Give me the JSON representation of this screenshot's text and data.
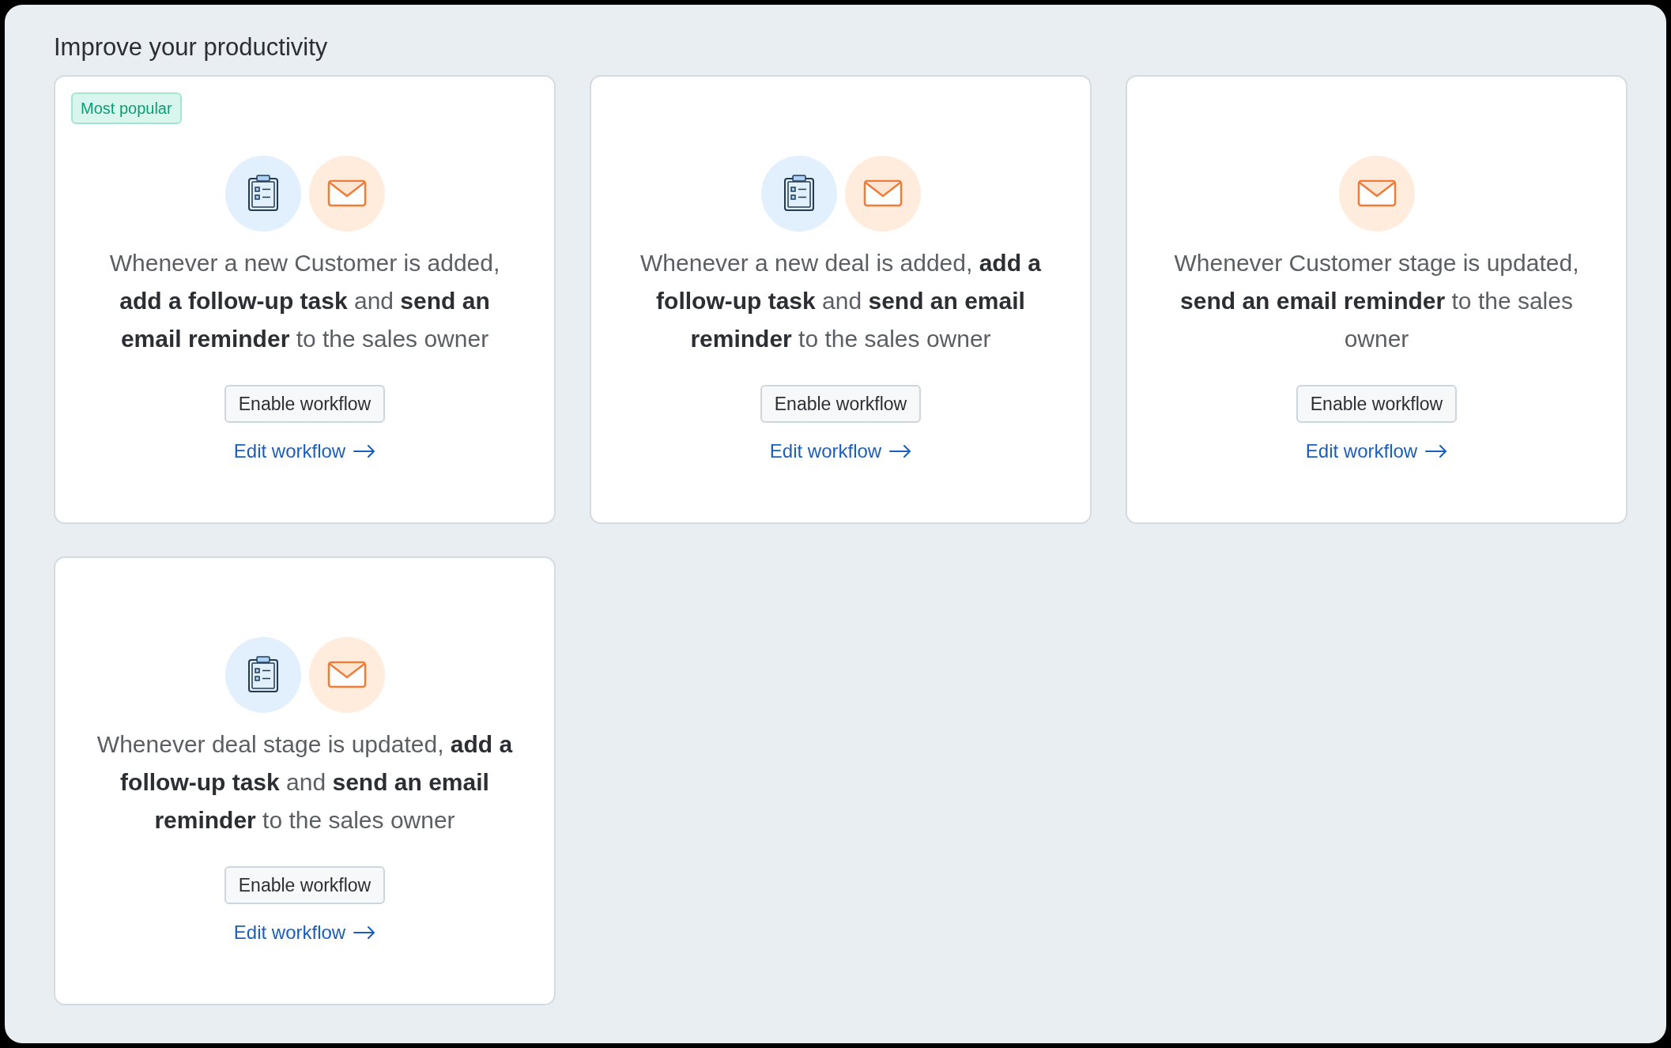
{
  "title": "Improve your productivity",
  "cards": [
    {
      "badge": "Most popular",
      "icons": [
        {
          "kind": "task"
        },
        {
          "kind": "email"
        }
      ],
      "description": "Whenever a new Customer is added, **add a follow-up task** and **send an email reminder** to the sales owner",
      "button": "Enable workflow",
      "link": "Edit workflow"
    },
    {
      "icons": [
        {
          "kind": "task"
        },
        {
          "kind": "email"
        }
      ],
      "description": "Whenever a new deal is added, **add a follow-up task** and **send an email reminder** to the sales owner",
      "button": "Enable workflow",
      "link": "Edit workflow"
    },
    {
      "icons": [
        {
          "kind": "email"
        }
      ],
      "description": "Whenever Customer stage is updated, **send an email reminder** to the sales owner",
      "button": "Enable workflow",
      "link": "Edit workflow"
    },
    {
      "icons": [
        {
          "kind": "task"
        },
        {
          "kind": "email"
        }
      ],
      "description": "Whenever deal stage is updated, **add a follow-up task** and **send an email reminder** to the sales owner",
      "button": "Enable workflow",
      "link": "Edit workflow"
    }
  ]
}
